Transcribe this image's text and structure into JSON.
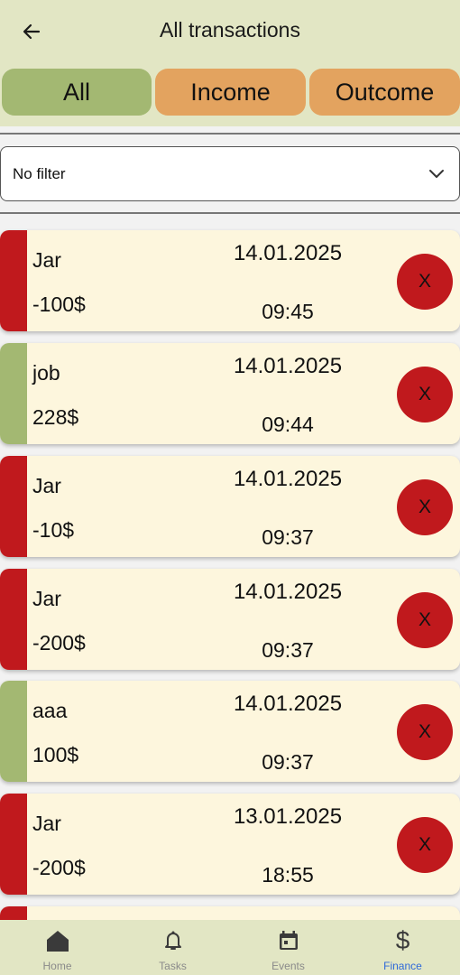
{
  "header": {
    "title": "All transactions",
    "back_icon": "arrow-left-icon"
  },
  "tabs": [
    {
      "label": "All",
      "selected": true
    },
    {
      "label": "Income",
      "selected": false
    },
    {
      "label": "Outcome",
      "selected": false
    }
  ],
  "filter": {
    "value": "No filter",
    "icon": "chevron-down-icon"
  },
  "transactions": [
    {
      "name": "Jar",
      "amount": "-100$",
      "date": "14.01.2025",
      "time": "09:45",
      "type": "outcome",
      "delete_label": "X"
    },
    {
      "name": "job",
      "amount": "228$",
      "date": "14.01.2025",
      "time": "09:44",
      "type": "income",
      "delete_label": "X"
    },
    {
      "name": "Jar",
      "amount": "-10$",
      "date": "14.01.2025",
      "time": "09:37",
      "type": "outcome",
      "delete_label": "X"
    },
    {
      "name": "Jar",
      "amount": "-200$",
      "date": "14.01.2025",
      "time": "09:37",
      "type": "outcome",
      "delete_label": "X"
    },
    {
      "name": "aaa",
      "amount": "100$",
      "date": "14.01.2025",
      "time": "09:37",
      "type": "income",
      "delete_label": "X"
    },
    {
      "name": "Jar",
      "amount": "-200$",
      "date": "13.01.2025",
      "time": "18:55",
      "type": "outcome",
      "delete_label": "X"
    }
  ],
  "bottom_nav": {
    "home": "Home",
    "tasks": "Tasks",
    "events": "Events",
    "finance": "Finance",
    "active": "finance"
  },
  "colors": {
    "income_stripe": "#a3b872",
    "outcome_stripe": "#c0191d",
    "bar_background": "#e2e6c4",
    "card_background": "#fdf6dd",
    "active_nav": "#2f6ad9"
  }
}
